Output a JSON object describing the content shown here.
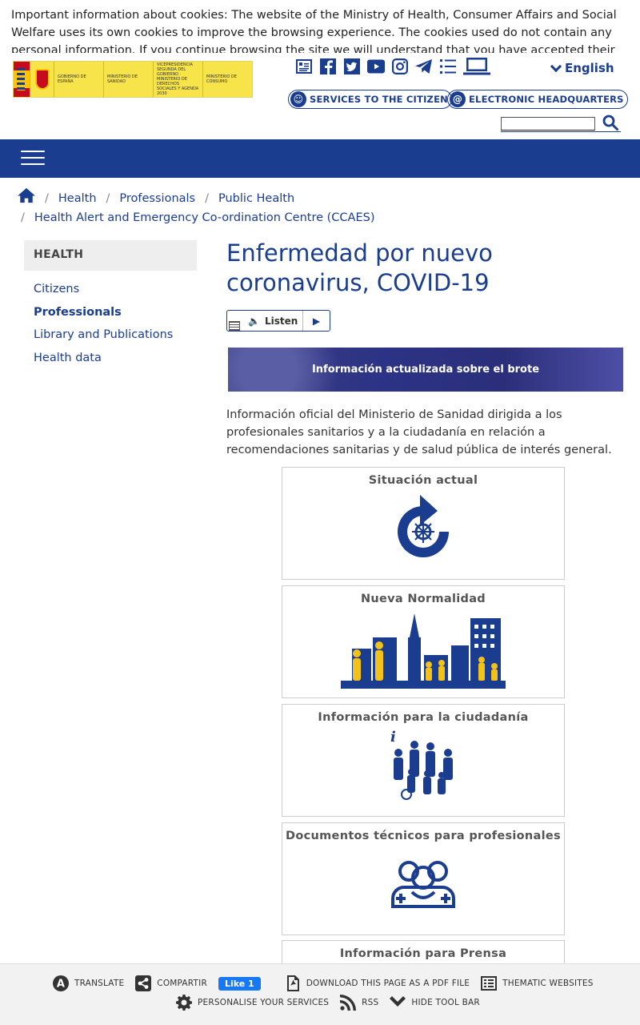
{
  "cookie_banner": {
    "text": "Important information about cookies: The website of the Ministry of Health, Consumer Affairs and Social Welfare uses its own cookies to improve the browsing experience. The cookies used do not contain any personal information. If you continue browsing the site we will understand that you have accepted their"
  },
  "header": {
    "logo": {
      "cell1": "Gobierno de España",
      "cell2": "Ministerio de Sanidad",
      "cell3": "Vicepresidencia Segunda del Gobierno · Ministerio de Derechos Sociales y Agenda 2030",
      "cell4": "Ministerio de Consumo"
    },
    "social_icons": [
      "pdf-icon",
      "facebook-icon",
      "twitter-icon",
      "youtube-icon",
      "instagram-icon",
      "telegram-icon",
      "list-icon",
      "laptop-icon"
    ],
    "language": "English",
    "services_label": "SERVICES TO THE CITIZEN",
    "headquarters_label": "ELECTRONIC HEADQUARTERS",
    "search": {
      "value": "",
      "placeholder": ""
    }
  },
  "breadcrumb": {
    "items": [
      "Health",
      "Professionals",
      "Public Health",
      "Health Alert and Emergency Co-ordination Centre (CCAES)"
    ]
  },
  "sidebar": {
    "heading": "HEALTH",
    "items": [
      "Citizens",
      "Professionals",
      "Library and Publications",
      "Health data"
    ],
    "active": "Professionals"
  },
  "main": {
    "title": "Enfermedad por nuevo coronavirus, COVID-19",
    "listen_label": "Listen",
    "banner_text": "Información actualizada sobre el brote",
    "intro": "Información oficial del Ministerio de Sanidad dirigida a los profesionales sanitarios y a la ciudadanía en relación a recomendaciones sanitarias y de salud pública de interés general.",
    "cards": [
      {
        "title": "Situación actual",
        "icon": "refresh-virus-icon"
      },
      {
        "title": "Nueva Normalidad",
        "icon": "city-people-icon"
      },
      {
        "title": "Información para la ciudadanía",
        "icon": "family-info-icon"
      },
      {
        "title": "Documentos técnicos para profesionales",
        "icon": "medical-team-icon"
      },
      {
        "title": "Información para Prensa",
        "icon": "press-icon"
      }
    ]
  },
  "toolbar": {
    "translate": "TRANSLATE",
    "share": "COMPARTIR",
    "fb_like": "Like 1",
    "pdf": "DOWNLOAD THIS PAGE AS A PDF FILE",
    "thematic": "THEMATIC WEBSITES",
    "personalise": "PERSONALISE YOUR SERVICES",
    "rss": "RSS",
    "hide": "HIDE TOOL BAR"
  },
  "colors": {
    "brand_blue": "#1a3d8f",
    "illustration_yellow": "#f2c21b"
  }
}
